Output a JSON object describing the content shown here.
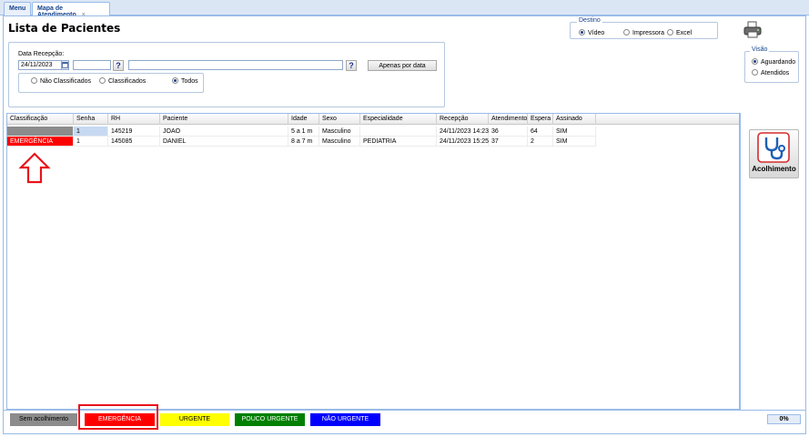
{
  "tabs": [
    {
      "label": "Menu"
    },
    {
      "label": "Mapa de Atendimento",
      "close": "×"
    }
  ],
  "page_title": "Lista de Pacientes",
  "destino": {
    "legend": "Destino",
    "options": [
      {
        "label": "Vídeo",
        "selected": true
      },
      {
        "label": "Impressora",
        "selected": false
      },
      {
        "label": "Excel",
        "selected": false
      }
    ]
  },
  "visao": {
    "legend": "Visão",
    "options": [
      {
        "label": "Aguardando",
        "selected": true
      },
      {
        "label": "Atendidos",
        "selected": false
      }
    ]
  },
  "filter": {
    "date_label": "Data Recepção:",
    "date_value": "24/11/2023",
    "apenas_label": "Apenas por data",
    "help_glyph": "?",
    "class_options": [
      {
        "label": "Não Classificados",
        "selected": false
      },
      {
        "label": "Classificados",
        "selected": false
      },
      {
        "label": "Todos",
        "selected": true
      }
    ]
  },
  "grid": {
    "columns": [
      "Classificação",
      "Senha",
      "RH",
      "Paciente",
      "Idade",
      "Sexo",
      "Especialidade",
      "Recepção",
      "Atendimento",
      "Espera",
      "Assinado"
    ],
    "rows": [
      {
        "classificacao": "",
        "senha": "1",
        "rh": "145219",
        "paciente": "JOAO",
        "idade": "5 a 1 m",
        "sexo": "Masculino",
        "especialidade": "",
        "recepcao": "24/11/2023 14:23",
        "atendimento": "36",
        "espera": "64",
        "assinado": "SIM",
        "class_color": "#8c8c8c"
      },
      {
        "classificacao": "EMERGÊNCIA",
        "senha": "1",
        "rh": "145085",
        "paciente": "DANIEL",
        "idade": "8 a 7 m",
        "sexo": "Masculino",
        "especialidade": "PEDIATRIA",
        "recepcao": "24/11/2023 15:25",
        "atendimento": "37",
        "espera": "2",
        "assinado": "SIM",
        "class_color": "#ff0000"
      }
    ]
  },
  "acolhimento_label": "Acolhimento",
  "legend_bar": [
    {
      "label": "Sem acolhimento",
      "bg": "#8c8c8c",
      "fg": "#000000"
    },
    {
      "label": "EMERGÊNCIA",
      "bg": "#ff0000",
      "fg": "#ffffff"
    },
    {
      "label": "URGENTE",
      "bg": "#ffff00",
      "fg": "#000000"
    },
    {
      "label": "POUCO URGENTE",
      "bg": "#008000",
      "fg": "#ffffff"
    },
    {
      "label": "NÃO URGENTE",
      "bg": "#0000ff",
      "fg": "#ffffff"
    }
  ],
  "progress": {
    "label": "0%",
    "value": 0
  },
  "colors": {
    "annotation_red": "#e8141c",
    "accent": "#15428b"
  }
}
